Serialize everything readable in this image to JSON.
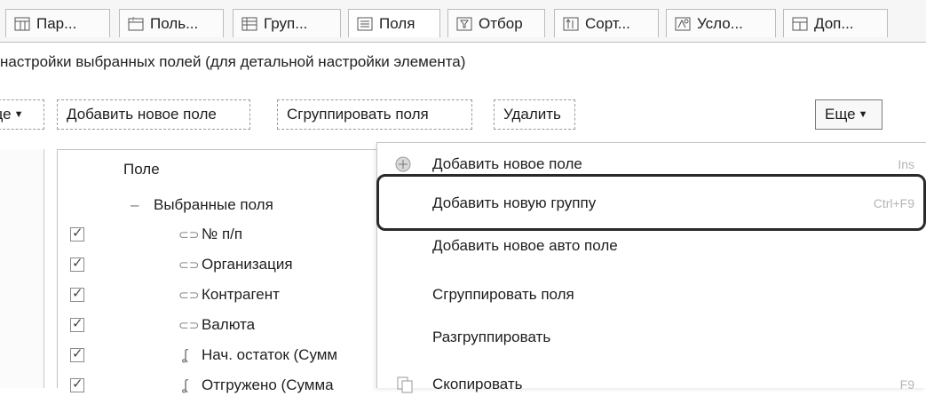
{
  "tabs": [
    {
      "label": "Пар...",
      "icon": "parameters-icon"
    },
    {
      "label": "Поль...",
      "icon": "user-fields-icon"
    },
    {
      "label": "Груп...",
      "icon": "grouping-icon"
    },
    {
      "label": "Поля",
      "icon": "fields-icon"
    },
    {
      "label": "Отбор",
      "icon": "filter-icon"
    },
    {
      "label": "Сорт...",
      "icon": "sort-icon"
    },
    {
      "label": "Усло...",
      "icon": "conditional-icon"
    },
    {
      "label": "Доп...",
      "icon": "additional-icon"
    }
  ],
  "description": "настройки выбранных полей (для детальной настройки элемента)",
  "toolbar": {
    "left_more": "Еще",
    "add_field": "Добавить новое поле",
    "group_fields": "Сгруппировать поля",
    "delete": "Удалить",
    "more": "Еще"
  },
  "tree": {
    "header": "Поле",
    "group": "Выбранные поля",
    "items": [
      {
        "label": "№ п/п",
        "checked": true,
        "icon": "field-icon"
      },
      {
        "label": "Организация",
        "checked": true,
        "icon": "field-icon"
      },
      {
        "label": "Контрагент",
        "checked": true,
        "icon": "field-icon"
      },
      {
        "label": "Валюта",
        "checked": true,
        "icon": "field-icon"
      },
      {
        "label": "Нач. остаток (Сумм",
        "checked": true,
        "icon": "resource-icon"
      },
      {
        "label": "Отгружено (Сумма",
        "checked": true,
        "icon": "resource-icon"
      }
    ]
  },
  "menu": {
    "items": [
      {
        "label": "Добавить новое поле",
        "shortcut": "Ins",
        "icon": "add-field-icon"
      },
      {
        "label": "Добавить новую группу",
        "shortcut": "Ctrl+F9",
        "highlighted": true
      },
      {
        "label": "Добавить новое авто поле",
        "shortcut": ""
      },
      {
        "label": "Сгруппировать поля",
        "shortcut": ""
      },
      {
        "label": "Разгруппировать",
        "shortcut": ""
      },
      {
        "label": "Скопировать",
        "shortcut": "F9",
        "icon": "copy-icon"
      }
    ]
  }
}
